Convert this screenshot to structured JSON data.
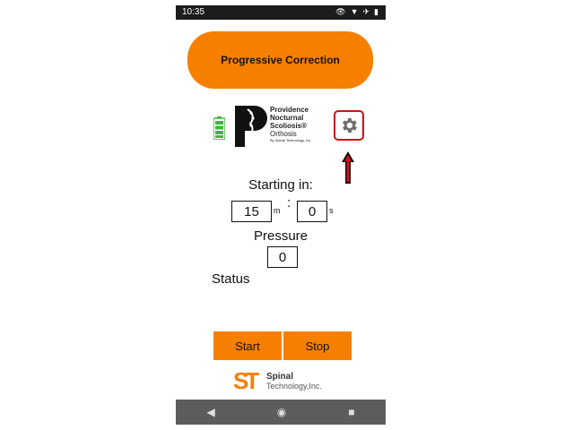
{
  "statusbar": {
    "time": "10:35",
    "icons": [
      "eye-icon",
      "wifi-icon",
      "airplane-icon",
      "battery-icon"
    ]
  },
  "header": {
    "title": "Progressive Correction"
  },
  "logo": {
    "line1": "Providence",
    "line2": "Nocturnal",
    "line3": "Scoliosis®",
    "line4": "Orthosis",
    "line5": "By Spinal Technology, Inc."
  },
  "timer": {
    "label": "Starting in:",
    "minutes": "15",
    "minutes_unit": "m",
    "separator": ":",
    "seconds": "0",
    "seconds_unit": "s"
  },
  "pressure": {
    "label": "Pressure",
    "value": "0"
  },
  "status": {
    "label": "Status"
  },
  "buttons": {
    "start": "Start",
    "stop": "Stop"
  },
  "footer": {
    "mark": "ST",
    "name": "Spinal",
    "sub": "Technology,Inc."
  },
  "colors": {
    "accent": "#f77f00",
    "highlight": "#d0101a",
    "battery": "#3fb83f"
  }
}
